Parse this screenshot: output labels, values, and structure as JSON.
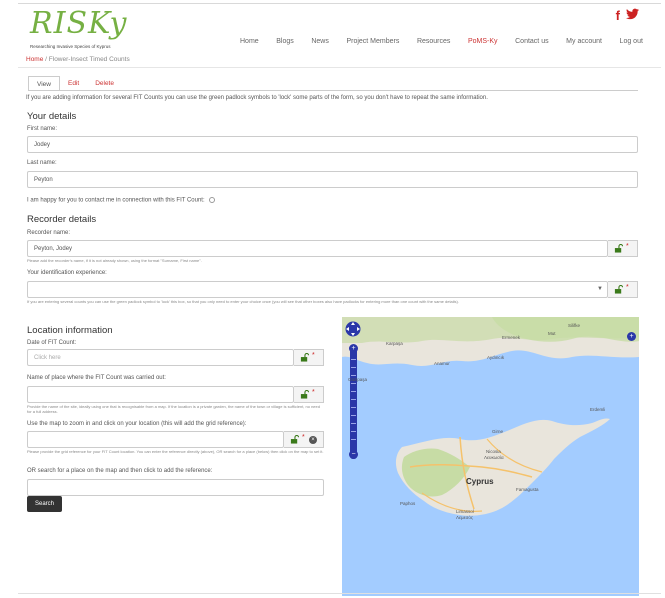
{
  "logo": {
    "word": "RISKy",
    "tagline": "Researching Invasive Species of Kyprus"
  },
  "social": {
    "facebook": "f",
    "twitter": "t"
  },
  "nav": {
    "items": [
      "Home",
      "Blogs",
      "News",
      "Project Members",
      "Resources",
      "PoMS-Ky",
      "Contact us",
      "My account",
      "Log out"
    ],
    "active_index": 5
  },
  "breadcrumb": {
    "home": "Home",
    "separator": "/",
    "current": "Flower-Insect Timed Counts"
  },
  "tabs": {
    "view": "View",
    "edit": "Edit",
    "delete": "Delete"
  },
  "intro": "If you are adding information for several FIT Counts you can use the green padlock symbols to 'lock' some parts of the form, so you don't have to repeat the same information.",
  "your_details": {
    "heading": "Your details",
    "first_name_label": "First name:",
    "first_name_value": "Jodey",
    "last_name_label": "Last name:",
    "last_name_value": "Peyton",
    "contact_label": "I am happy for you to contact me in connection with this FIT Count:"
  },
  "recorder": {
    "heading": "Recorder details",
    "name_label": "Recorder name:",
    "name_value": "Peyton, Jodey",
    "name_help": "Please add the recorder's name, if it is not already shown, using the format \"Surname, First name\".",
    "experience_label": "Your identification experience:",
    "experience_help": "If you are entering several counts you can use the green padlock symbol to 'lock' this box, so that you only need to enter your choice once (you will see that other boxes also have padlocks for entering more than one count with the same details)."
  },
  "location": {
    "heading": "Location information",
    "date_label": "Date of FIT Count:",
    "date_placeholder": "Click here",
    "place_label": "Name of place where the FIT Count was carried out:",
    "place_help": "Provide the name of the site, ideally using one that is recognisable from a map. If the location is a private garden, the name of the town or village is sufficient, no need for a full address.",
    "map_label": "Use the map to zoom in and click on your location (this will add the grid reference):",
    "grid_help": "Please provide the grid reference for your FIT Count location. You can enter the reference directly (above), OR search for a place (below) then click on the map to set it.",
    "search_label": "OR search for a place on the map and then click to add the reference:",
    "search_button": "Search",
    "required_mark": "*"
  },
  "map": {
    "labels": {
      "kyrenia": "Girne",
      "anamur": "Anamur",
      "silifke": "Silifke",
      "ermenek": "Ermenek",
      "mut": "Mut",
      "gazipasa": "Gazipaşa",
      "aydincik": "Aydıncık",
      "erdemli": "Erdemli",
      "cyprus": "Cyprus",
      "nicosia": "Nicosia",
      "nicosia_local": "Λευκωσία",
      "limassol": "Limassol",
      "limassol_local": "Λεμεσός",
      "famagusta": "Famagusta",
      "paphos": "Paphos",
      "karpasia": "Karpaşa"
    },
    "colors": {
      "sea": "#a3ccff",
      "land": "#e9e5dc",
      "green": "#c7dca5",
      "road": "#f5c26b"
    }
  }
}
